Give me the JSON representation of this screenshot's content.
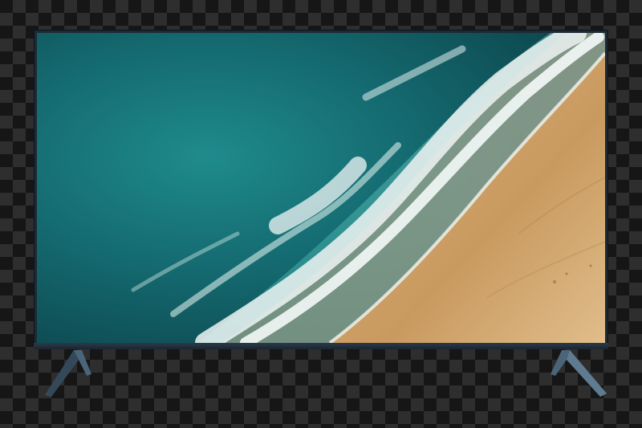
{
  "scene": {
    "background": "transparency-checkerboard",
    "object": "flat-screen-tv",
    "screen_image": "aerial-ocean-waves-on-sandy-beach",
    "colors": {
      "ocean_deep": "#0f4a52",
      "ocean_mid": "#1e8a8a",
      "foam": "#e8f1ef",
      "sand": "#cfa56e",
      "bezel": "#1d2a36",
      "stand": "#3d5468"
    }
  }
}
